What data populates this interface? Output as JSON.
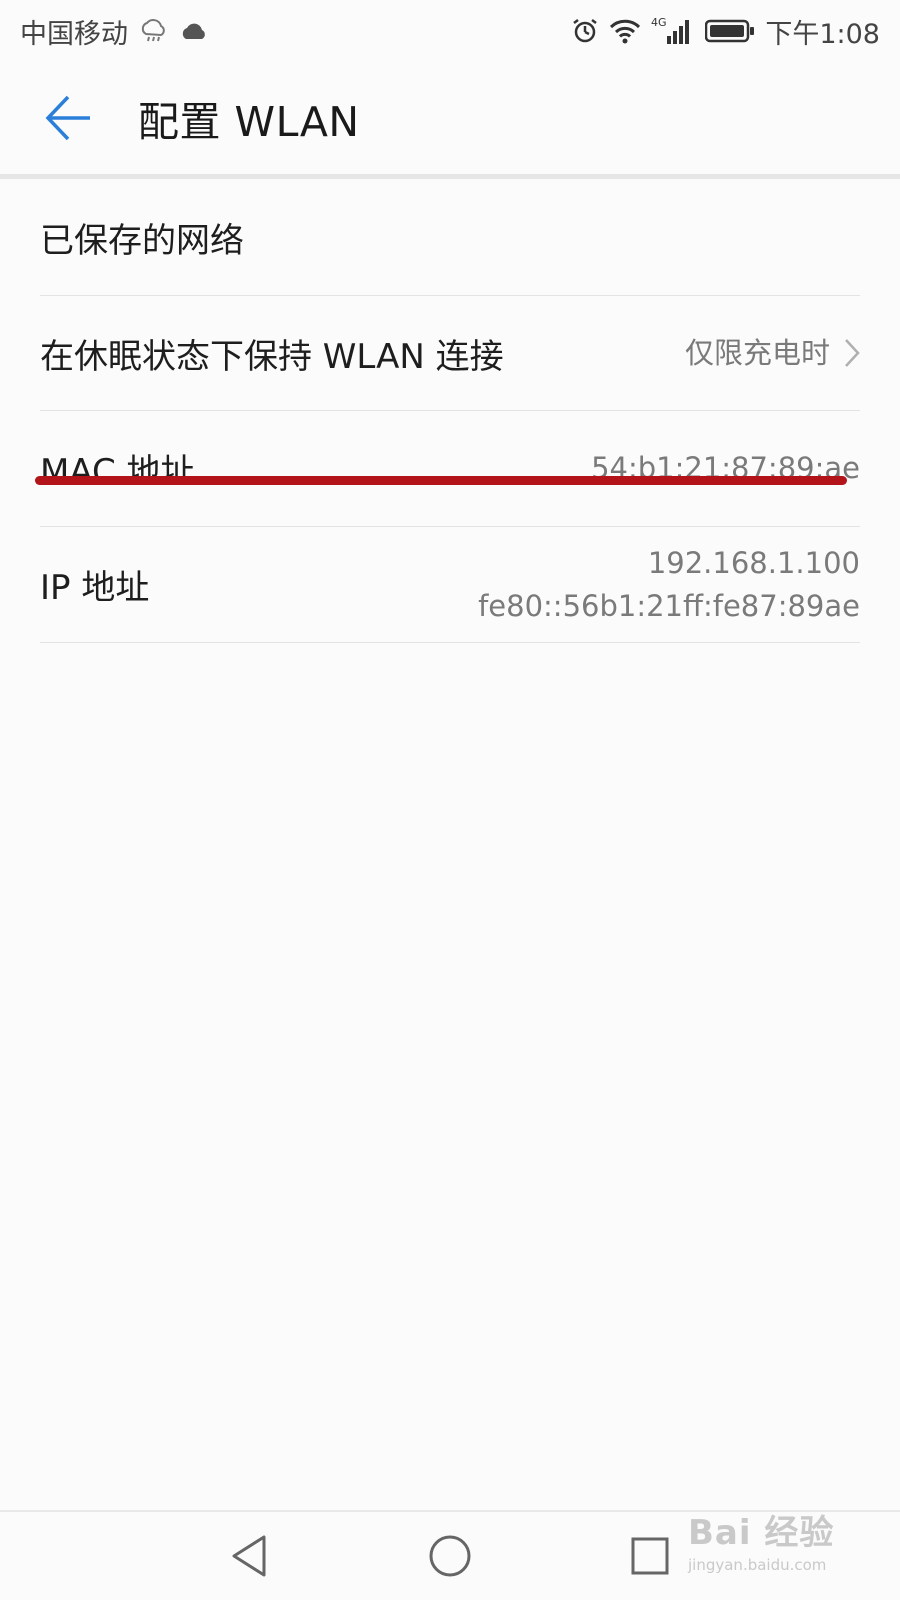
{
  "status_bar": {
    "carrier": "中国移动",
    "network_type": "4G",
    "time": "下午1:08",
    "icons": [
      "cloud-rain-icon",
      "cloud-icon",
      "alarm-icon",
      "wifi-icon",
      "signal-icon",
      "battery-icon"
    ]
  },
  "header": {
    "back_icon": "back-arrow-icon",
    "title": "配置 WLAN"
  },
  "settings": {
    "saved_networks": {
      "label": "已保存的网络"
    },
    "keep_wlan_on_sleep": {
      "label": "在休眠状态下保持 WLAN 连接",
      "value": "仅限充电时"
    },
    "mac_address": {
      "label": "MAC 地址",
      "value": "54:b1:21:87:89:ae"
    },
    "ip_address": {
      "label": "IP 地址",
      "ipv4": "192.168.1.100",
      "ipv6": "fe80::56b1:21ff:fe87:89ae"
    }
  },
  "nav_bar": {
    "buttons": [
      "back-triangle-icon",
      "home-circle-icon",
      "recents-square-icon"
    ]
  },
  "watermark": {
    "logo": "Bai 经验",
    "url": "jingyan.baidu.com"
  },
  "colors": {
    "accent": "#2b7fd9",
    "highlight": "#b3141a",
    "background": "#fbfbfb",
    "secondary_text": "#7a7a7a"
  }
}
